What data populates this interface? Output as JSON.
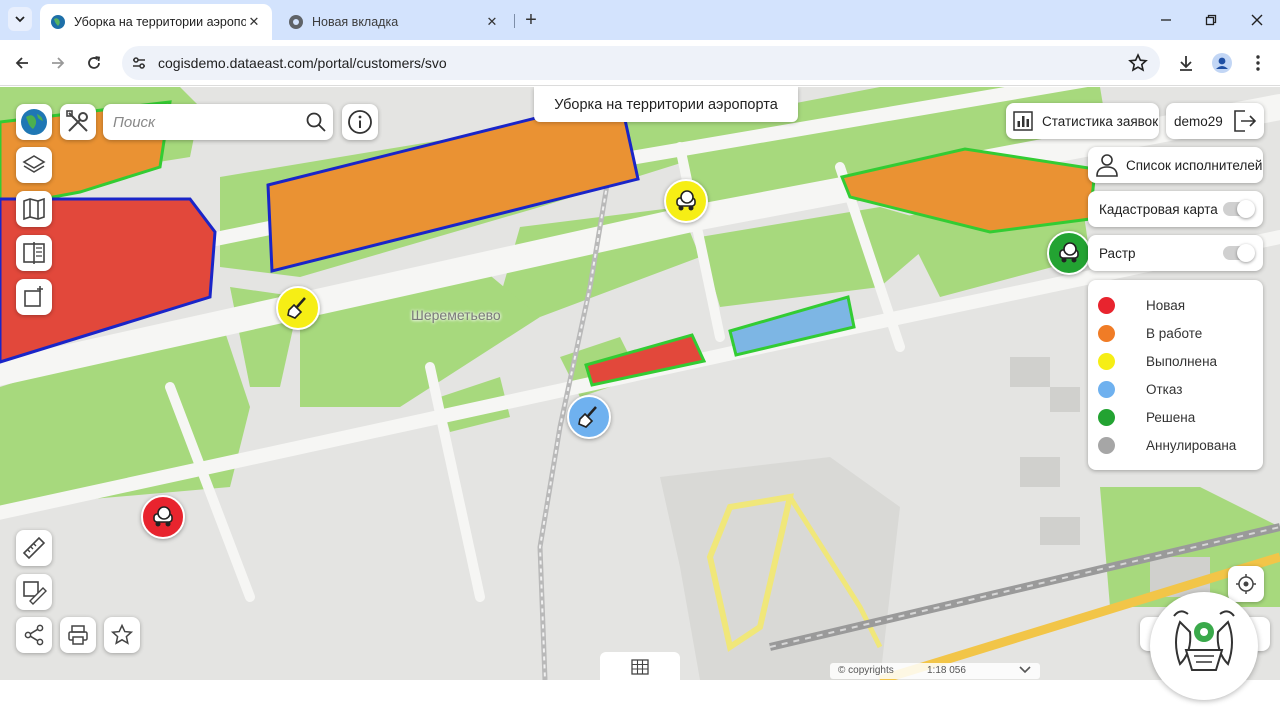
{
  "browser": {
    "tabs": [
      {
        "title": "Уборка на территории аэропо",
        "active": true
      },
      {
        "title": "Новая вкладка",
        "active": false
      }
    ],
    "url": "cogisdemo.dataeast.com/portal/customers/svo"
  },
  "map": {
    "title": "Уборка на территории аэропорта",
    "search_placeholder": "Поиск",
    "place_label": "Шереметьево",
    "copyrights": "© copyrights",
    "scale": "1:18 056"
  },
  "right_panel": {
    "stats_label": "Статистика заявок",
    "user": "demo29",
    "executors_label": "Список исполнителей",
    "cadastral_label": "Кадастровая карта",
    "raster_label": "Растр"
  },
  "legend": [
    {
      "label": "Новая",
      "color": "#e8242e"
    },
    {
      "label": "В работе",
      "color": "#f07c26"
    },
    {
      "label": "Выполнена",
      "color": "#f6ee15"
    },
    {
      "label": "Отказ",
      "color": "#6fb1ef"
    },
    {
      "label": "Решена",
      "color": "#23a332"
    },
    {
      "label": "Аннулирована",
      "color": "#a6a6a6"
    }
  ],
  "colors": {
    "polygon_orange": "#ea9233",
    "polygon_red": "#e2483b",
    "polygon_blue": "#7db6e4",
    "border_blue": "#1a25c8",
    "border_green": "#33cc33",
    "grass": "#a7d97d"
  }
}
